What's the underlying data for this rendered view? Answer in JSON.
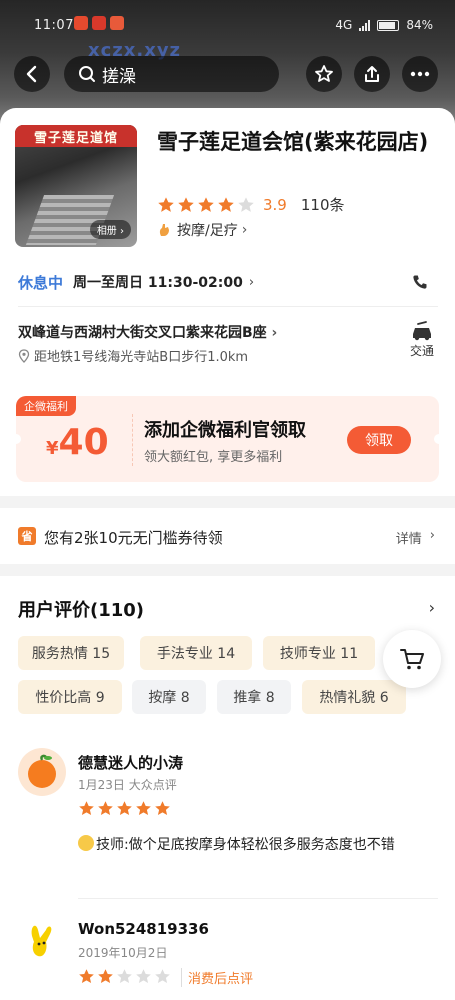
{
  "status_bar": {
    "time": "11:07",
    "battery": "84%",
    "network": "4G"
  },
  "watermark": "xczx.xyz",
  "navbar": {
    "search_text": "搓澡"
  },
  "shop": {
    "photo_sign_text": "雪子莲足道馆",
    "album_label": "相册",
    "name": "雪子莲足道会馆(紫来花园店)",
    "rating": {
      "score": "3.9",
      "stars_filled": 4,
      "stars_total": 5,
      "review_count_label": "110条"
    },
    "category": "按摩/足疗",
    "hours": {
      "status": "休息中",
      "text": "周一至周日 11:30-02:00"
    },
    "address": "双峰道与西湖村大街交叉口紫来花园B座",
    "subway": "距地铁1号线海光寺站B口步行1.0km",
    "traffic_label": "交通"
  },
  "coupon": {
    "tag": "企微福利",
    "currency": "¥",
    "amount": "40",
    "title": "添加企微福利官领取",
    "subtitle": "领大额红包, 享更多福利",
    "button": "领取"
  },
  "voucher": {
    "icon_text": "省",
    "text": "您有2张10元无门槛券待领",
    "detail_label": "详情"
  },
  "reviews": {
    "title": "用户评价(110)",
    "tags": [
      {
        "label": "服务热情 15"
      },
      {
        "label": "手法专业 14"
      },
      {
        "label": "技师专业 11"
      },
      {
        "label": "性价比高 9"
      },
      {
        "label": "按摩 8"
      },
      {
        "label": "推拿 8"
      },
      {
        "label": "热情礼貌 6"
      }
    ],
    "items": [
      {
        "name": "德慧迷人的小涛",
        "meta": "1月23日 大众点评",
        "stars": 5,
        "text": "技师:做个足底按摩身体轻松很多服务态度也不错"
      },
      {
        "name": "Won524819336",
        "meta": "2019年10月2日",
        "stars": 2,
        "post_label": "消费后点评"
      }
    ]
  },
  "colors": {
    "accent": "#f07b2b",
    "coupon_red": "#f45b35",
    "status_blue": "#3d7ad8"
  }
}
